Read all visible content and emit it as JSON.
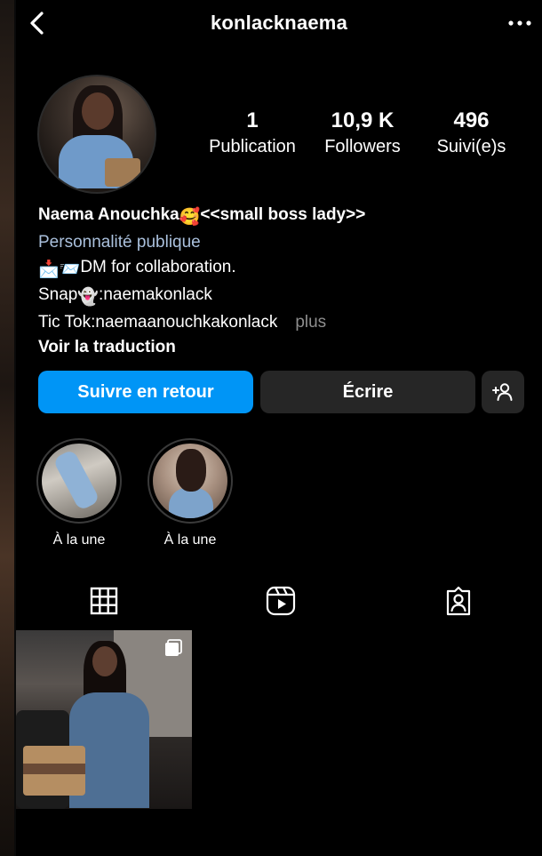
{
  "header": {
    "username": "konlacknaema"
  },
  "stats": {
    "posts": {
      "value": "1",
      "label": "Publication"
    },
    "followers": {
      "value": "10,9 K",
      "label": "Followers"
    },
    "following": {
      "value": "496",
      "label": "Suivi(e)s"
    }
  },
  "bio": {
    "name": "Naema Anouchka",
    "name_emoji": "🥰",
    "name_suffix": "<<small boss lady>>",
    "category": "Personnalité publique",
    "line1_emojis": "📩📨",
    "line1_text": "DM for collaboration.",
    "line2_prefix": "Snap",
    "line2_emoji": "👻",
    "line2_text": ":naemakonlack",
    "line3_text": "Tic Tok:naemaanouchkakonlack",
    "more_label": "plus",
    "translate_label": "Voir la traduction"
  },
  "buttons": {
    "follow_back": "Suivre en retour",
    "message": "Écrire"
  },
  "highlights": [
    {
      "label": "À la une"
    },
    {
      "label": "À la une"
    }
  ],
  "tabs": [
    "grid-icon",
    "reels-icon",
    "tagged-icon"
  ],
  "colors": {
    "accent": "#0095f6",
    "button_secondary": "#262626",
    "category_text": "#aac0dc",
    "muted_text": "#8e8e8e",
    "background": "#000000"
  }
}
